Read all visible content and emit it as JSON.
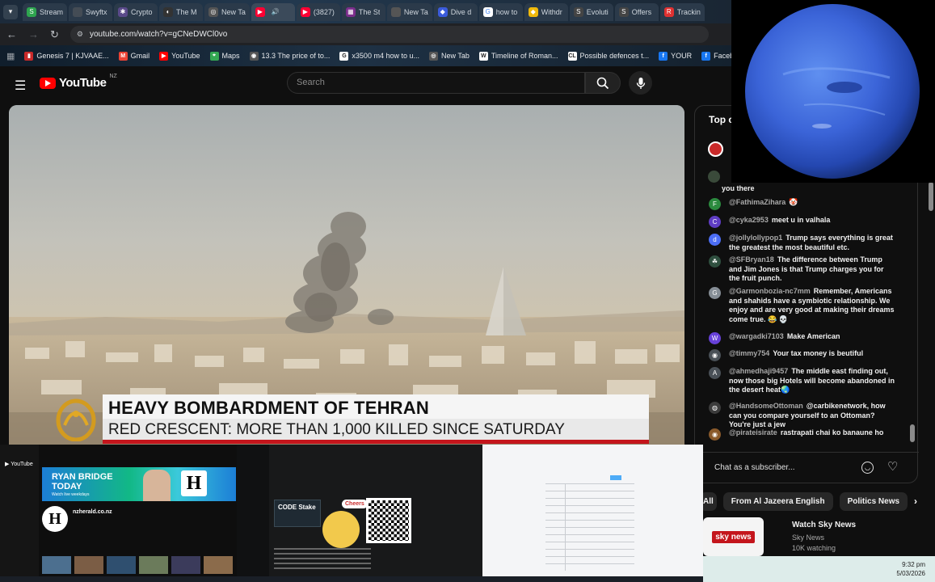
{
  "browser": {
    "tabs": [
      {
        "label": "Stream",
        "color": "#2ea44f",
        "glyph": "S"
      },
      {
        "label": "Swyftx",
        "color": "#444c55",
        "glyph": ""
      },
      {
        "label": "Crypto",
        "color": "#5a4a8a",
        "glyph": "✱"
      },
      {
        "label": "The M",
        "color": "#333",
        "glyph": "◐"
      },
      {
        "label": "New Ta",
        "color": "#555",
        "glyph": "◎"
      },
      {
        "label": "",
        "color": "#ff0033",
        "glyph": "▶",
        "active": true
      },
      {
        "label": "(3827)",
        "color": "#ff0033",
        "glyph": "▶"
      },
      {
        "label": "The St",
        "color": "#7b2d8b",
        "glyph": "▦"
      },
      {
        "label": "New Ta",
        "color": "#555",
        "glyph": ""
      },
      {
        "label": "Dive d",
        "color": "#3b5bdb",
        "glyph": "◆"
      },
      {
        "label": "how to",
        "color": "#fff",
        "glyph": "G"
      },
      {
        "label": "Withdr",
        "color": "#f0b90b",
        "glyph": "◆"
      },
      {
        "label": "Evoluti",
        "color": "#444",
        "glyph": "S"
      },
      {
        "label": "Offers",
        "color": "#444",
        "glyph": "S"
      },
      {
        "label": "Trackin",
        "color": "#e03131",
        "glyph": "R"
      }
    ],
    "url": "youtube.com/watch?v=gCNeDWCl0vo",
    "bookmarks": [
      {
        "label": "Genesis 7 | KJVAAE...",
        "color": "#c92a2a",
        "glyph": "▮"
      },
      {
        "label": "Gmail",
        "color": "#ea4335",
        "glyph": "M"
      },
      {
        "label": "YouTube",
        "color": "#ff0000",
        "glyph": "▶"
      },
      {
        "label": "Maps",
        "color": "#34a853",
        "glyph": "⌖"
      },
      {
        "label": "13.3 The price of to...",
        "color": "#555",
        "glyph": "◉"
      },
      {
        "label": "x3500 m4 how to u...",
        "color": "#fff",
        "glyph": "G"
      },
      {
        "label": "New Tab",
        "color": "#555",
        "glyph": "◎"
      },
      {
        "label": "Timeline of Roman...",
        "color": "#fff",
        "glyph": "W"
      },
      {
        "label": "Possible defences t...",
        "color": "#fff",
        "glyph": "CL"
      },
      {
        "label": "YOUR",
        "color": "#1877f2",
        "glyph": "f"
      },
      {
        "label": "Facebook green",
        "color": "#1877f2",
        "glyph": "f"
      }
    ]
  },
  "youtube": {
    "logo_text": "YouTube",
    "country_code": "NZ",
    "search_placeholder": "Search"
  },
  "video": {
    "headline": "HEAVY BOMBARDMENT OF TEHRAN",
    "subheadline": "RED CRESCENT: MORE THAN 1,000 KILLED SINCE SATURDAY"
  },
  "chat": {
    "title": "Top c",
    "partial_top": "you there",
    "messages": [
      {
        "user": "@FathimaZihara",
        "text": "🤡",
        "avatar": "F",
        "color": "#2b8a3e"
      },
      {
        "user": "@cyka2953",
        "text": "meet u in valhala",
        "avatar": "C",
        "color": "#5f3dc4"
      },
      {
        "user": "@jollylollypop1",
        "text": "Trump says everything is great the greatest the most beautiful etc.",
        "avatar": "d",
        "color": "#4c6ef5"
      },
      {
        "user": "@SFBryan18",
        "text": "The difference between Trump and Jim Jones is that Trump charges you for the fruit punch.",
        "avatar": "☘",
        "color": "#2f4f3f"
      },
      {
        "user": "@Garmonbozia-nc7mm",
        "text": "Remember, Americans and shahids have a symbiotic relationship. We enjoy and are very good at making their dreams come true. 😂 💀",
        "avatar": "G",
        "color": "#868e96"
      },
      {
        "user": "@wargadki7103",
        "text": "Make American",
        "avatar": "W",
        "color": "#6741d9"
      },
      {
        "user": "@timmy754",
        "text": "Your tax money is beutiful",
        "avatar": "◉",
        "color": "#495057"
      },
      {
        "user": "@ahmedhaji9457",
        "text": "The middle east finding out, now those big Hotels will become abandoned in the desert heat🌏",
        "avatar": "A",
        "color": "#495057"
      },
      {
        "user": "@HandsomeOttoman",
        "text": "@carbikenetwork, how can you compare yourself to an Ottoman? You're just a jew",
        "avatar": "◍",
        "color": "#3c3c3c"
      },
      {
        "user": "@pirateisirate",
        "text": "rastrapati chai ko banaune ho",
        "avatar": "◉",
        "color": "#8a5a2b"
      }
    ],
    "input_placeholder": "Chat as a subscriber..."
  },
  "chips": [
    "All",
    "From Al Jazeera English",
    "Politics News"
  ],
  "recommended": {
    "title": "Watch Sky News",
    "channel": "Sky News",
    "meta": "10K watching",
    "brand": "sky news"
  },
  "clock": {
    "time": "9:32 pm",
    "date": "5/03/2026"
  },
  "thumbnails": {
    "nz_banner": "RYAN BRIDGE TODAY",
    "nz_banner_sub": "Watch live weekdays",
    "nz_channel": "nzherald.co.nz",
    "code_stake": "CODE Stake",
    "cheers": "Cheers"
  }
}
